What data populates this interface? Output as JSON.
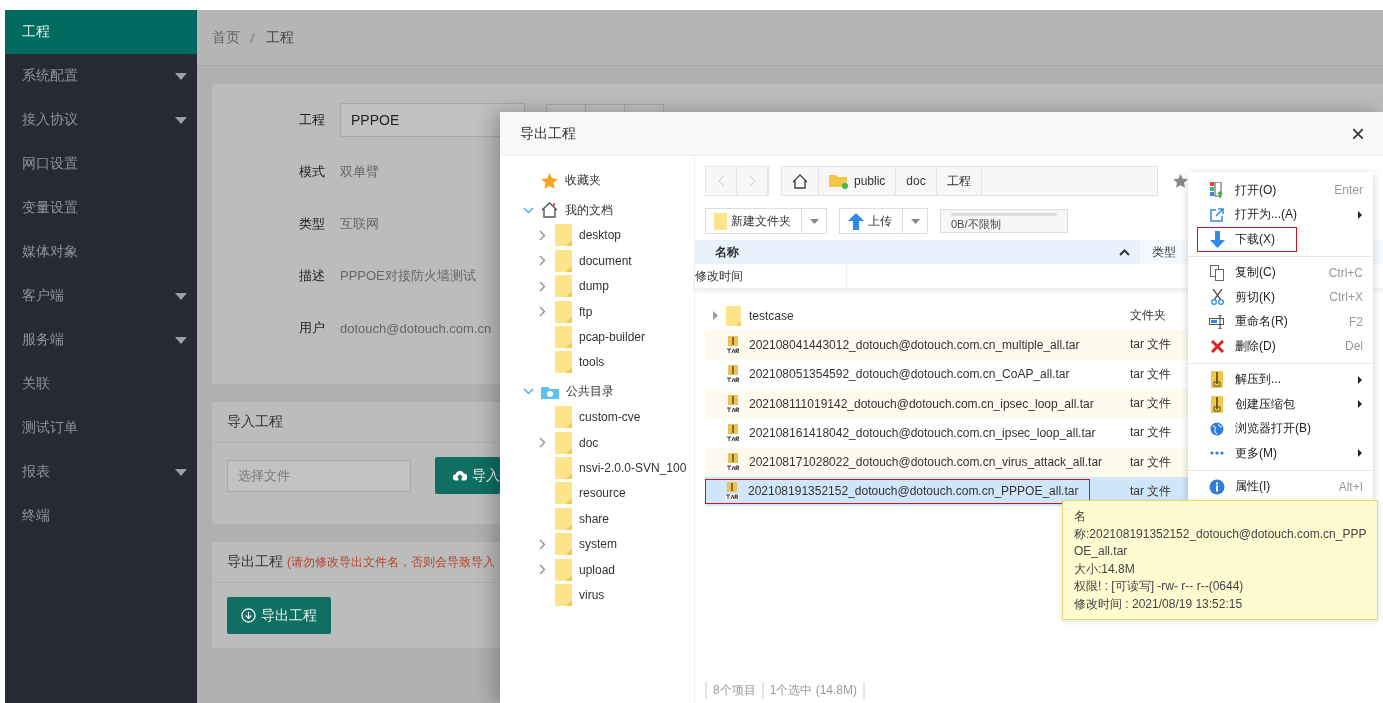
{
  "sidebar": {
    "items": [
      {
        "label": "工程",
        "selected": true,
        "dropdown": false
      },
      {
        "label": "系统配置",
        "selected": false,
        "dropdown": true
      },
      {
        "label": "接入协议",
        "selected": false,
        "dropdown": true
      },
      {
        "label": "网口设置",
        "selected": false,
        "dropdown": false
      },
      {
        "label": "变量设置",
        "selected": false,
        "dropdown": false
      },
      {
        "label": "媒体对象",
        "selected": false,
        "dropdown": false
      },
      {
        "label": "客户端",
        "selected": false,
        "dropdown": true
      },
      {
        "label": "服务端",
        "selected": false,
        "dropdown": true
      },
      {
        "label": "关联",
        "selected": false,
        "dropdown": false
      },
      {
        "label": "测试订单",
        "selected": false,
        "dropdown": false
      },
      {
        "label": "报表",
        "selected": false,
        "dropdown": true
      },
      {
        "label": "终端",
        "selected": false,
        "dropdown": false
      }
    ]
  },
  "breadcrumb": [
    "首页",
    "工程"
  ],
  "project_card": {
    "name_label": "工程",
    "name_value": "PPPOE",
    "fields": [
      {
        "label": "模式",
        "value": "双单臂"
      },
      {
        "label": "类型",
        "value": "互联网"
      },
      {
        "label": "描述",
        "value": "PPPOE对接防火墙测试"
      },
      {
        "label": "用户",
        "value": "dotouch@dotouch.com.cn"
      }
    ]
  },
  "import_card": {
    "title": "导入工程",
    "placeholder": "选择文件",
    "button": "导入"
  },
  "export_card": {
    "title": "导出工程",
    "note": "(请勿修改导出文件名，否则会导致导入",
    "button": "导出工程"
  },
  "dialog": {
    "title": "导出工程",
    "close": "×",
    "tree": [
      {
        "label": "收藏夹",
        "kind": "favorites"
      },
      {
        "label": "我的文档",
        "kind": "home",
        "expanded": true,
        "children": [
          {
            "label": "desktop",
            "expandable": true
          },
          {
            "label": "document",
            "expandable": true
          },
          {
            "label": "dump",
            "expandable": true
          },
          {
            "label": "ftp",
            "expandable": true
          },
          {
            "label": "pcap-builder",
            "expandable": false
          },
          {
            "label": "tools",
            "expandable": false
          }
        ]
      },
      {
        "label": "公共目录",
        "kind": "public",
        "expanded": true,
        "children": [
          {
            "label": "custom-cve",
            "expandable": false
          },
          {
            "label": "doc",
            "expandable": true
          },
          {
            "label": "nsvi-2.0.0-SVN_100",
            "expandable": false
          },
          {
            "label": "resource",
            "expandable": false
          },
          {
            "label": "share",
            "expandable": false
          },
          {
            "label": "system",
            "expandable": true
          },
          {
            "label": "upload",
            "expandable": true
          },
          {
            "label": "virus",
            "expandable": false
          }
        ]
      }
    ],
    "path": [
      "public",
      "doc",
      "工程"
    ],
    "new_folder": "新建文件夹",
    "upload": "上传",
    "quota": {
      "text": "0B/不限制",
      "level": 0
    },
    "columns": [
      {
        "label": "名称"
      },
      {
        "label": "类型"
      },
      {
        "label": "修改时间"
      }
    ],
    "files": [
      {
        "name": "testcase",
        "type": "文件夹",
        "kind": "folder",
        "selected": false
      },
      {
        "name": "202108041443012_dotouch@dotouch.com.cn_multiple_all.tar",
        "type": "tar 文件",
        "kind": "tar",
        "selected": false
      },
      {
        "name": "202108051354592_dotouch@dotouch.com.cn_CoAP_all.tar",
        "type": "tar 文件",
        "kind": "tar",
        "selected": false
      },
      {
        "name": "202108111019142_dotouch@dotouch.com.cn_ipsec_loop_all.tar",
        "type": "tar 文件",
        "kind": "tar",
        "selected": false
      },
      {
        "name": "202108161418042_dotouch@dotouch.com.cn_ipsec_loop_all.tar",
        "type": "tar 文件",
        "kind": "tar",
        "selected": false
      },
      {
        "name": "202108171028022_dotouch@dotouch.com.cn_virus_attack_all.tar",
        "type": "tar 文件",
        "kind": "tar",
        "selected": false
      },
      {
        "name": "202108191352152_dotouch@dotouch.com.cn_PPPOE_all.tar",
        "type": "tar 文件",
        "kind": "tar",
        "selected": true
      }
    ],
    "status": [
      "8个项目",
      "1个选中 (14.8M)"
    ]
  },
  "context_menu": {
    "groups": [
      [
        {
          "label": "打开(O)",
          "shortcut": "Enter",
          "submenu": false,
          "highlighted": false
        },
        {
          "label": "打开为...(A)",
          "submenu": true,
          "highlighted": false
        },
        {
          "label": "下载(X)",
          "submenu": false,
          "highlighted": true
        }
      ],
      [
        {
          "label": "复制(C)",
          "shortcut": "Ctrl+C",
          "submenu": false,
          "highlighted": false
        },
        {
          "label": "剪切(K)",
          "shortcut": "Ctrl+X",
          "submenu": false,
          "highlighted": false
        },
        {
          "label": "重命名(R)",
          "shortcut": "F2",
          "submenu": false,
          "highlighted": false
        },
        {
          "label": "删除(D)",
          "shortcut": "Del",
          "submenu": false,
          "highlighted": false
        }
      ],
      [
        {
          "label": "解压到...",
          "submenu": true,
          "highlighted": false
        },
        {
          "label": "创建压缩包",
          "submenu": true,
          "highlighted": false
        },
        {
          "label": "浏览器打开(B)",
          "submenu": false,
          "highlighted": false
        },
        {
          "label": "更多(M)",
          "submenu": true,
          "highlighted": false
        }
      ],
      [
        {
          "label": "属性(I)",
          "shortcut": "Alt+I",
          "submenu": false,
          "highlighted": false
        }
      ]
    ]
  },
  "tooltip": {
    "lines": [
      "名",
      "称:202108191352152_dotouch@dotouch.com.cn_PPP",
      "OE_all.tar",
      "大小:14.8M",
      "权限! : [可读写] -rw- r-- r--(0644)",
      "修改时间 : 2021/08/19 13:52:15"
    ]
  }
}
